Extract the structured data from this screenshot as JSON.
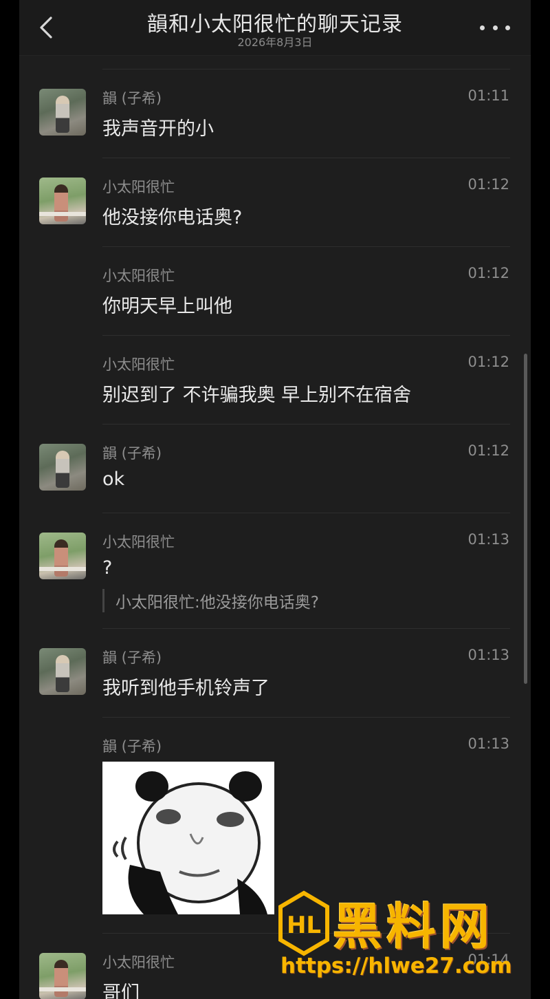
{
  "header": {
    "title": "韻和小太阳很忙的聊天记录",
    "date": "2026年8月3日"
  },
  "messages": [
    {
      "sender": "韻 (子希)",
      "time": "01:11",
      "text": "我声音开的小",
      "avatar": "yun"
    },
    {
      "sender": "小太阳很忙",
      "time": "01:12",
      "text": "他没接你电话奥?",
      "avatar": "sun"
    },
    {
      "sender": "小太阳很忙",
      "time": "01:12",
      "text": "你明天早上叫他"
    },
    {
      "sender": "小太阳很忙",
      "time": "01:12",
      "text": "别迟到了 不许骗我奥 早上别不在宿舍"
    },
    {
      "sender": "韻 (子希)",
      "time": "01:12",
      "text": "ok",
      "avatar": "yun"
    },
    {
      "sender": "小太阳很忙",
      "time": "01:13",
      "text": "?",
      "quote": "小太阳很忙:他没接你电话奥?",
      "avatar": "sun"
    },
    {
      "sender": "韻 (子希)",
      "time": "01:13",
      "text": "我听到他手机铃声了",
      "avatar": "yun"
    },
    {
      "sender": "韻 (子希)",
      "time": "01:13",
      "sticker": "panda-meme-sticker"
    },
    {
      "sender": "小太阳很忙",
      "time": "01:14",
      "text": "哥们",
      "avatar": "sun"
    }
  ],
  "watermark": {
    "brand": "黑料网",
    "url": "https://hlwe27.com"
  },
  "colors": {
    "background": "#1e1e1e",
    "text": "#e9e9e9",
    "meta": "#8e8e8e",
    "watermark": "#f7b500"
  }
}
